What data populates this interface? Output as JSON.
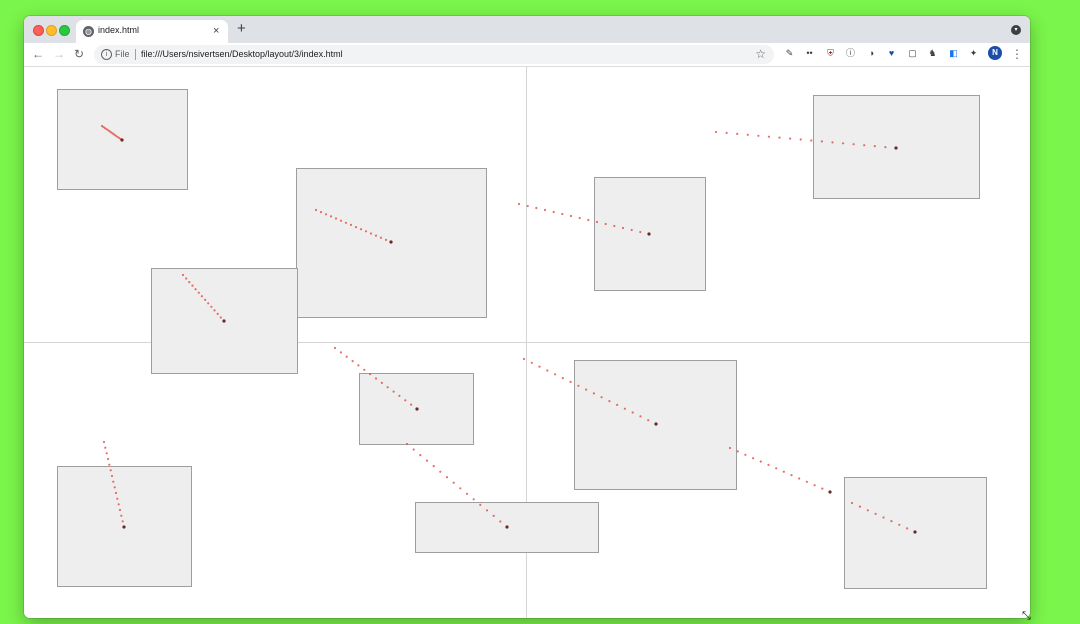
{
  "window": {
    "traffic_lights": [
      "close",
      "minimize",
      "maximize"
    ],
    "tab": {
      "title": "index.html",
      "favicon": "globe-icon",
      "close_icon": "×"
    },
    "new_tab_icon": "+",
    "profile_menu_icon": "▾"
  },
  "toolbar": {
    "back_icon": "←",
    "forward_icon": "→",
    "reload_icon": "↻",
    "info_icon": "i",
    "scheme_label": "File",
    "url": "file:///Users/nsivertsen/Desktop/layout/3/index.html",
    "bookmark_icon": "☆",
    "extensions": [
      "pin-icon",
      "glasses-icon",
      "shield-icon",
      "circle-info-icon",
      "moon-icon",
      "heart-icon",
      "square-icon",
      "bell-icon",
      "tag-icon",
      "puzzle-icon"
    ],
    "extension_glyphs": [
      "✎",
      "••",
      "⛨",
      "ⓘ",
      "◑",
      "♥",
      "▢",
      "♞",
      "◧",
      "✦"
    ],
    "avatar_letter": "N",
    "menu_icon": "⋮"
  },
  "page": {
    "boxes": 10,
    "box_color": "#eeeeee",
    "box_border": "#9e9e9e",
    "trail_color": "#e0554a",
    "trail_head_color": "#6b2a2a"
  },
  "colors": {
    "desktop": "#7af54b",
    "tabbar": "#dee1e6"
  },
  "cursor_icon": "⤡"
}
